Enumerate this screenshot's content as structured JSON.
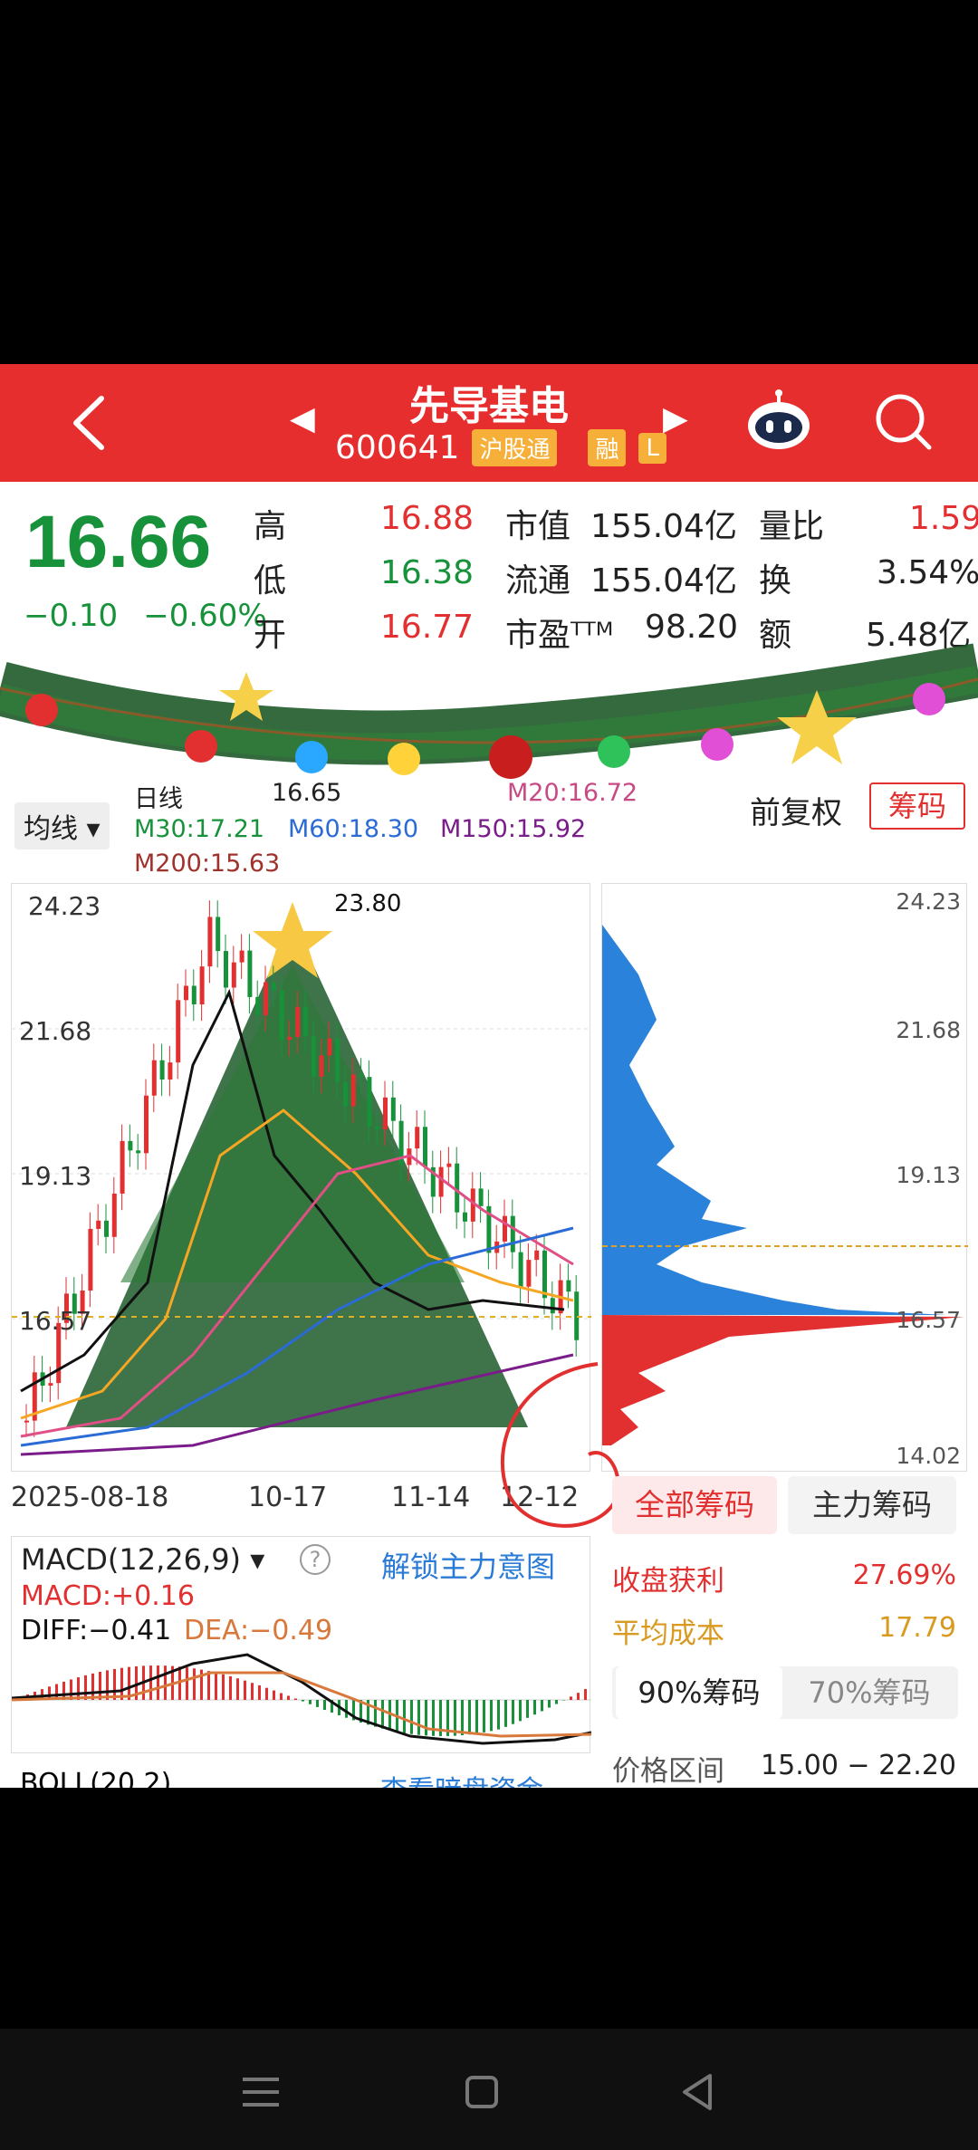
{
  "header": {
    "stock_name": "先导基电",
    "stock_code": "600641",
    "badge_connect": "沪股通",
    "badge_margin": "融",
    "badge_l": "L"
  },
  "quote": {
    "price": "16.66",
    "change": "−0.10",
    "change_pct": "−0.60%",
    "high_label": "高",
    "high_val": "16.88",
    "low_label": "低",
    "low_val": "16.38",
    "open_label": "开",
    "open_val": "16.77",
    "mcap_label": "市值",
    "mcap_val": "155.04亿",
    "float_label": "流通",
    "float_val": "155.04亿",
    "pe_label": "市盈ᵀᵀᴹ",
    "pe_val": "98.20",
    "vol_ratio_label": "量比",
    "vol_ratio_val": "1.59",
    "turnover_label": "换",
    "turnover_val": "3.54%",
    "amount_label": "额",
    "amount_val": "5.48亿"
  },
  "ma": {
    "ma_select": "均线",
    "period": "日线",
    "ma5_partial": "16.65",
    "ma20": "M20:16.72",
    "m30": "M30:17.21",
    "m60": "M60:18.30",
    "m150": "M150:15.92",
    "m200": "M200:15.63",
    "adjust": "前复权",
    "chip_tab": "筹码"
  },
  "chart": {
    "y_labels": [
      "24.23",
      "21.68",
      "19.13",
      "16.57"
    ],
    "peak_label": "23.80",
    "dates": [
      "2025-08-18",
      "10-17",
      "11-14",
      "12-12"
    ]
  },
  "chip": {
    "y_labels": [
      "24.23",
      "21.68",
      "19.13",
      "16.57",
      "14.02"
    ],
    "all_chips": "全部筹码",
    "main_chips": "主力筹码",
    "profit_label": "收盘获利",
    "profit_val": "27.69%",
    "avg_cost_label": "平均成本",
    "avg_cost_val": "17.79",
    "tab_90": "90%筹码",
    "tab_70": "70%筹码",
    "range_label": "价格区间",
    "range_val": "15.00 − 22.20"
  },
  "macd": {
    "select": "MACD(12,26,9)",
    "help": "?",
    "unlock": "解锁主力意图",
    "macd_val": "MACD:+0.16",
    "diff": "DIFF:−0.41",
    "dea": "DEA:−0.49"
  },
  "boll": {
    "select": "BOLL(20,2)",
    "link": "查看暗盘资金"
  },
  "chart_data": {
    "type": "line",
    "x": [
      "2025-08-18",
      "10-17",
      "11-14",
      "12-12"
    ],
    "series": [
      {
        "name": "price",
        "values": [
          14.5,
          23.8,
          18.2,
          16.66
        ]
      }
    ],
    "ylim": [
      14.02,
      24.23
    ]
  }
}
